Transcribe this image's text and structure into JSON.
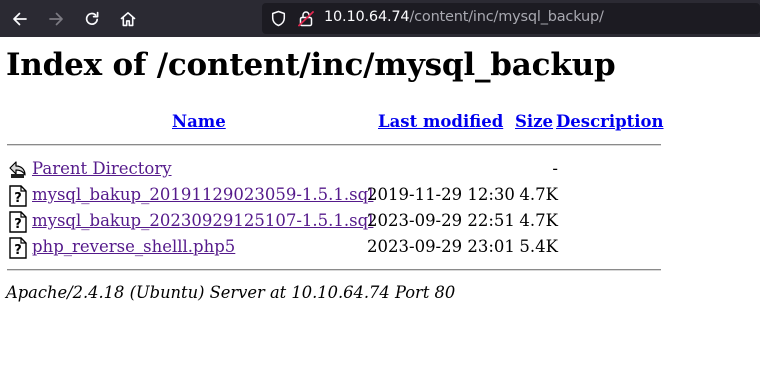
{
  "browser": {
    "url_host": "10.10.64.74",
    "url_path": "/content/inc/mysql_backup/"
  },
  "page": {
    "title": "Index of /content/inc/mysql_backup",
    "columns": {
      "name": "Name",
      "last_modified": "Last modified",
      "size": "Size",
      "description": "Description"
    },
    "parent": {
      "label": "Parent Directory",
      "size": "-"
    },
    "files": [
      {
        "name": "mysql_bakup_20191129023059-1.5.1.sql",
        "modified": "2019-11-29 12:30",
        "size": "4.7K"
      },
      {
        "name": "mysql_bakup_20230929125107-1.5.1.sql",
        "modified": "2023-09-29 22:51",
        "size": "4.7K"
      },
      {
        "name": "php_reverse_shelll.php5",
        "modified": "2023-09-29 23:01",
        "size": "5.4K"
      }
    ],
    "footer": "Apache/2.4.18 (Ubuntu) Server at 10.10.64.74 Port 80"
  }
}
